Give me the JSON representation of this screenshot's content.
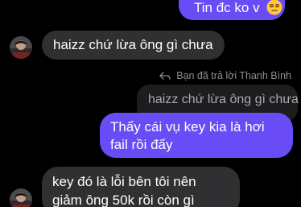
{
  "messages": {
    "top_outgoing": {
      "text": "Tin đc ko v",
      "emoji": "unamused-face"
    },
    "incoming_1": {
      "text": "haizz chứ lừa ông gì chưa"
    },
    "reply": {
      "header": "Bạn đã trả lời Thanh Bình",
      "quoted_text": "haizz chứ lừa ông gì chưa",
      "text": "Thấy cái vụ key kia là hơi fail rồi đấy"
    },
    "incoming_2": {
      "text": "key đó là lỗi bên tôi nên giảm ông 50k rồi còn gì"
    }
  },
  "colors": {
    "background": "#000000",
    "outgoing_bubble": "#6a4cf6",
    "incoming_bubble": "#303033",
    "quoted_bubble": "#1d1d20",
    "meta_text": "#8e8e93"
  }
}
